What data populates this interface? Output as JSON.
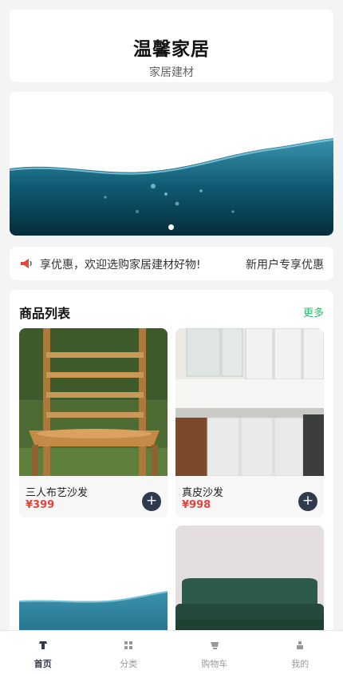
{
  "header": {
    "shop_name": "温馨家居",
    "subtitle": "家居建材"
  },
  "banner": {
    "slide_count": 1,
    "active_slide": 1
  },
  "notice": {
    "icon": "megaphone-icon",
    "text": "享优惠，欢迎选购家居建材好物!",
    "text_repeat": "新用户专享优惠"
  },
  "goods": {
    "title": "商品列表",
    "more_label": "更多",
    "add_symbol": "+",
    "items": [
      {
        "name": "三人布艺沙发",
        "price": "¥399",
        "image": "wooden-chair-photo"
      },
      {
        "name": "真皮沙发",
        "price": "¥998",
        "image": "white-kitchen-photo"
      },
      {
        "name": "",
        "price": "",
        "image": "ocean-water-photo"
      },
      {
        "name": "",
        "price": "",
        "image": "green-sofa-photo"
      }
    ]
  },
  "tabbar": {
    "active": "首页",
    "items": [
      {
        "label": "首页",
        "icon": "shirt-icon"
      },
      {
        "label": "分类",
        "icon": "grid-icon"
      },
      {
        "label": "购物车",
        "icon": "cart-icon"
      },
      {
        "label": "我的",
        "icon": "user-icon"
      }
    ]
  },
  "colors": {
    "accent": "#2e3a4d",
    "price": "#e0443a",
    "more_link": "#2db86a",
    "background": "#f4f4f5"
  }
}
